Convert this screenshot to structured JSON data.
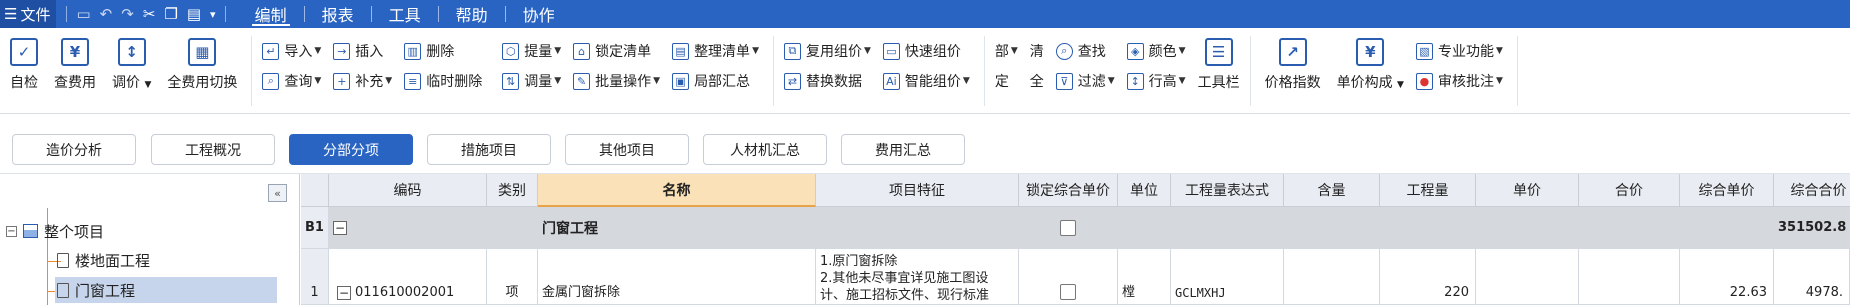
{
  "menubar": {
    "file_label": "文件",
    "menus": [
      "编制",
      "报表",
      "工具",
      "帮助",
      "协作"
    ],
    "active_menu": "编制"
  },
  "ribbon": {
    "self_check": "自检",
    "view_fee": "查费用",
    "adjust_price": "调价",
    "full_fee_switch": "全费用切换",
    "import": "导入",
    "query": "查询",
    "insert": "插入",
    "supplement": "补充",
    "delete": "删除",
    "temp_delete": "临时删除",
    "extract": "提量",
    "adjust_qty": "调量",
    "lock_list": "锁定清单",
    "batch_op": "批量操作",
    "organize_list": "整理清单",
    "partial_summary": "局部汇总",
    "reuse_price": "复用组价",
    "replace_data": "替换数据",
    "quick_price": "快速组价",
    "smart_price": "智能组价",
    "find": "查找",
    "filter": "过滤",
    "color": "颜色",
    "row_height": "行高",
    "toolbar": "工具栏",
    "price_index": "价格指数",
    "unit_price_comp": "单价构成",
    "pro_function": "专业功能",
    "review_approve": "审核批注",
    "small_glyphs": [
      "部",
      "定",
      "清",
      "全"
    ]
  },
  "tabs": [
    "造价分析",
    "工程概况",
    "分部分项",
    "措施项目",
    "其他项目",
    "人材机汇总",
    "费用汇总"
  ],
  "active_tab": "分部分项",
  "tree": {
    "collapse_glyph": "«",
    "root": "整个项目",
    "children": [
      "楼地面工程",
      "门窗工程"
    ],
    "selected": "门窗工程"
  },
  "grid": {
    "columns": [
      "编码",
      "类别",
      "名称",
      "项目特征",
      "锁定综合单价",
      "单位",
      "工程量表达式",
      "含量",
      "工程量",
      "单价",
      "合价",
      "综合单价",
      "综合合价"
    ],
    "rows": [
      {
        "row_no": "B1",
        "code": "",
        "category": "",
        "name": "门窗工程",
        "feature": "",
        "unit": "",
        "expr": "",
        "qty": "",
        "unit_price": "",
        "total": "",
        "comp_unit_price": "",
        "comp_total": "351502.8"
      },
      {
        "row_no": "1",
        "code": "011610002001",
        "category": "项",
        "name": "金属门窗拆除",
        "feature_lines": [
          "1.原门窗拆除",
          "2.其他未尽事宜详见施工图设",
          "计、施工招标文件、现行标准"
        ],
        "unit": "樘",
        "expr": "GCLMXHJ",
        "qty": "220",
        "unit_price": "",
        "total": "",
        "comp_unit_price": "22.63",
        "comp_total": "4978."
      }
    ]
  }
}
